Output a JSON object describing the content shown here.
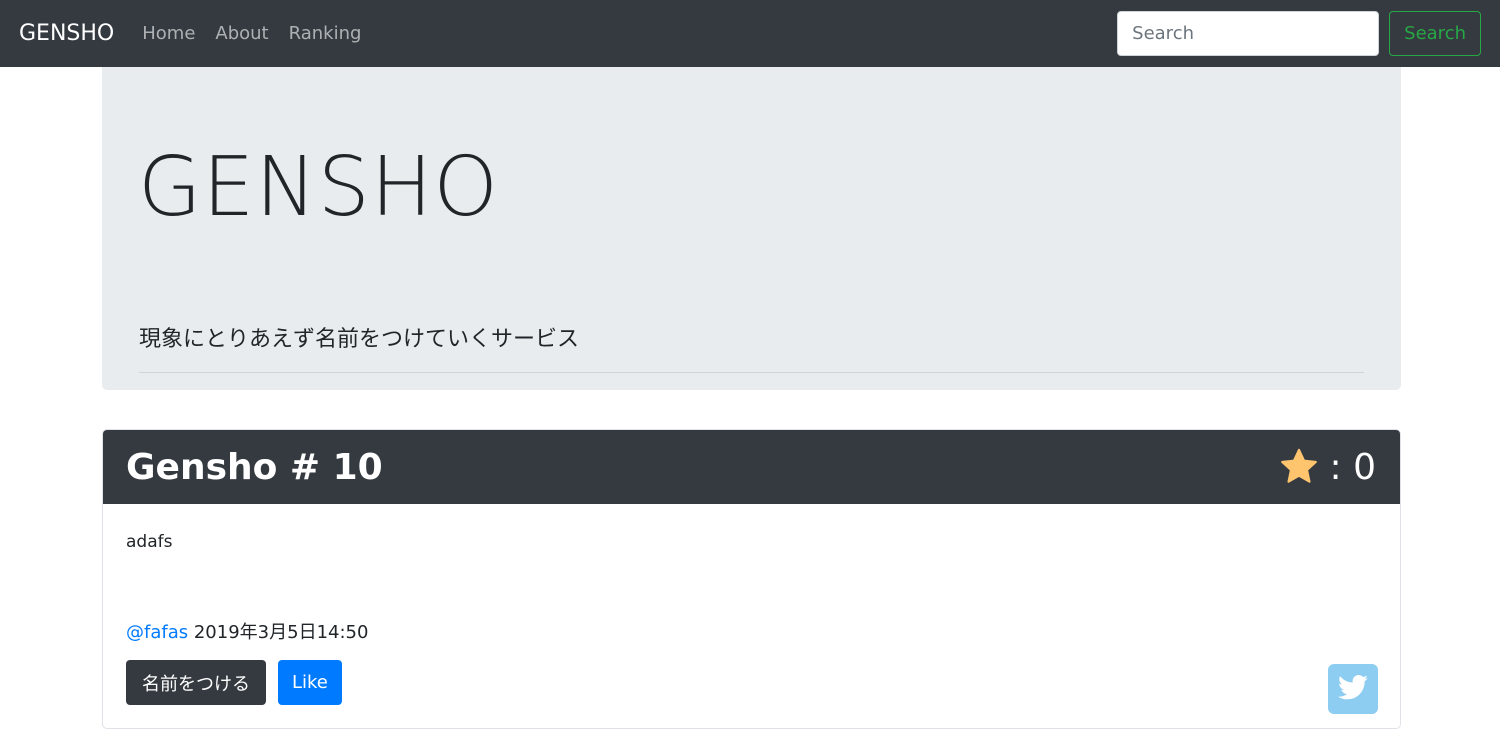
{
  "navbar": {
    "brand": "GENSHO",
    "links": [
      "Home",
      "About",
      "Ranking"
    ],
    "search": {
      "placeholder": "Search",
      "button_label": "Search"
    }
  },
  "jumbotron": {
    "title": "GENSHO",
    "subtitle": "現象にとりあえず名前をつけていくサービス"
  },
  "card": {
    "title": "Gensho # 10",
    "rating_text": ": 0",
    "rating_value": 0,
    "description": "adafs",
    "user": "@fafas",
    "timestamp": "2019年3月5日14:50",
    "name_button_label": "名前をつける",
    "like_button_label": "Like"
  },
  "colors": {
    "navbar_bg": "#343a40",
    "jumbotron_bg": "#e9ecef",
    "link_blue": "#007bff",
    "success_green": "#28a745",
    "star": "#ffc56e",
    "twitter": "#8dcdf2"
  },
  "icons": {
    "rating": "star-icon",
    "share": "twitter-icon"
  }
}
